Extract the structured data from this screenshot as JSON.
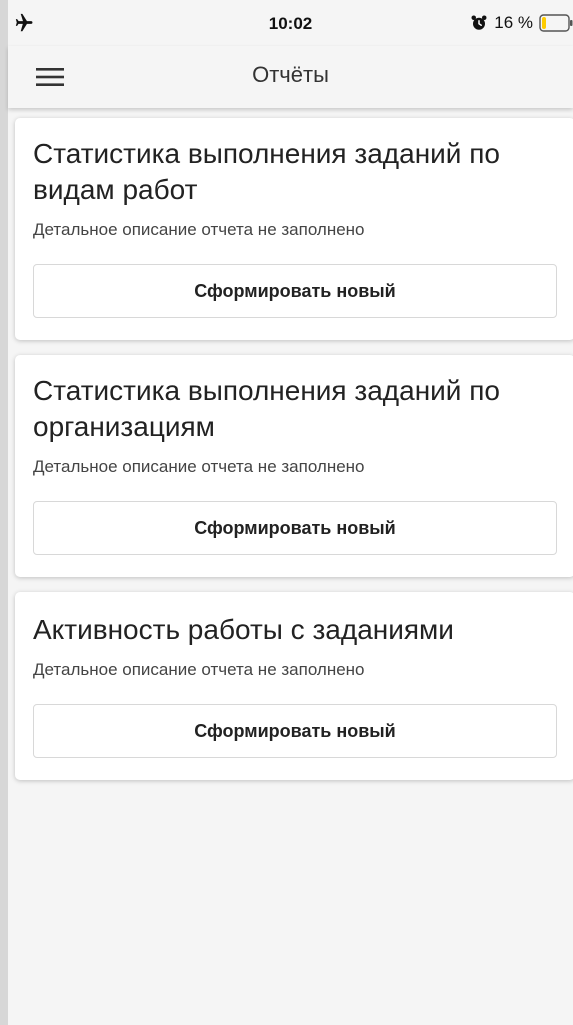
{
  "status_bar": {
    "time": "10:02",
    "battery_text": "16 %",
    "left_icon": "airplane-icon",
    "right_icons": [
      "alarm-icon",
      "battery-icon"
    ],
    "battery_level": 0.16,
    "battery_color": "#ffcc00"
  },
  "app_bar": {
    "title": "Отчёты",
    "menu_icon": "hamburger-menu-icon"
  },
  "reports": [
    {
      "title": "Статистика выполнения заданий по видам работ",
      "description": "Детальное описание отчета не заполнено",
      "button_label": "Сформировать новый"
    },
    {
      "title": "Статистика выполнения заданий по организациям",
      "description": "Детальное описание отчета не заполнено",
      "button_label": "Сформировать новый"
    },
    {
      "title": "Активность работы с заданиями",
      "description": "Детальное описание отчета не заполнено",
      "button_label": "Сформировать новый"
    }
  ]
}
